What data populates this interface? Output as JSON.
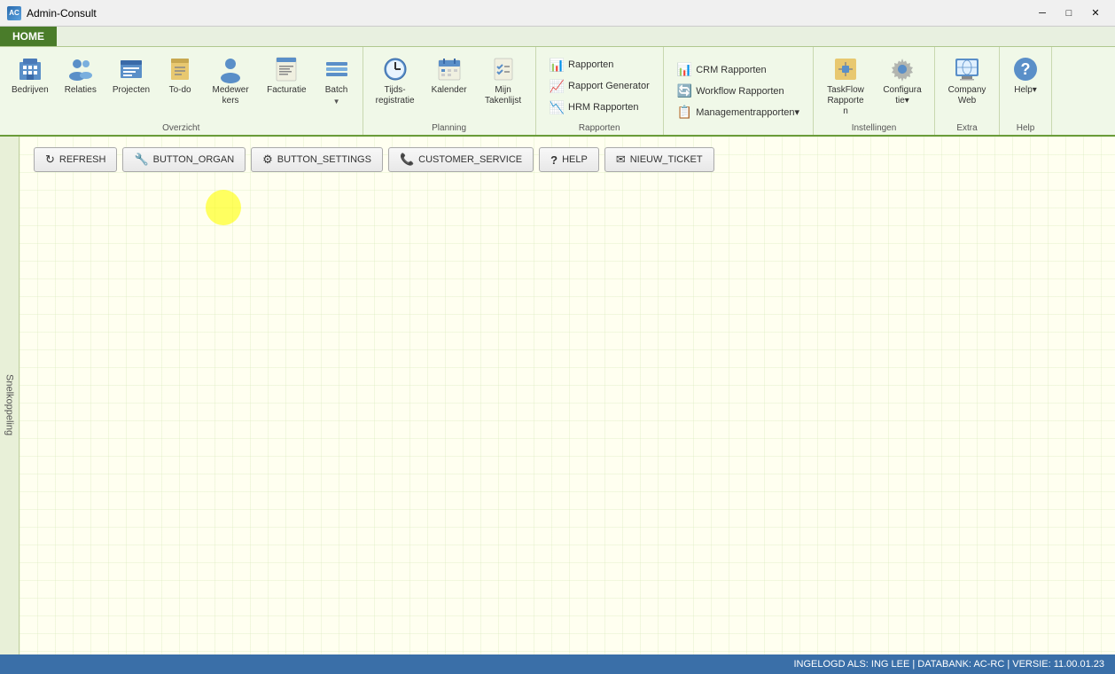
{
  "app": {
    "title": "Admin-Consult",
    "icon": "AC"
  },
  "titlebar": {
    "minimize": "─",
    "maximize": "□",
    "close": "✕"
  },
  "ribbon": {
    "home_tab": "HOME",
    "groups": {
      "overzicht": {
        "label": "Overzicht",
        "items": [
          {
            "id": "bedrijven",
            "label": "Bedrijven",
            "icon": "🏢"
          },
          {
            "id": "relaties",
            "label": "Relaties",
            "icon": "👥"
          },
          {
            "id": "projecten",
            "label": "Projecten",
            "icon": "📋"
          },
          {
            "id": "todo",
            "label": "To-do",
            "icon": "☑"
          },
          {
            "id": "medewerkers",
            "label": "Medewerkers",
            "icon": "👤"
          },
          {
            "id": "facturatie",
            "label": "Facturatie",
            "icon": "📄"
          },
          {
            "id": "batch",
            "label": "Batch",
            "icon": "📦",
            "has_arrow": true
          }
        ]
      },
      "planning": {
        "label": "Planning",
        "items": [
          {
            "id": "tijdsregistratie",
            "label": "Tijds­registratie",
            "icon": "⏱"
          },
          {
            "id": "kalender",
            "label": "Kalender",
            "icon": "📅"
          },
          {
            "id": "taken",
            "label": "Mijn Takenlijst",
            "icon": "📝"
          }
        ]
      },
      "rapporten": {
        "label": "Rapporten",
        "items": [
          {
            "id": "rapporten",
            "label": "Rapporten",
            "icon": "📊"
          },
          {
            "id": "rapport_generator",
            "label": "Rapport Generator",
            "icon": "📈"
          },
          {
            "id": "hrm_rapporten",
            "label": "HRM Rapporten",
            "icon": "📉"
          },
          {
            "id": "crm_rapporten",
            "label": "CRM Rapporten",
            "icon": "📊"
          },
          {
            "id": "workflow_rapporten",
            "label": "Workflow Rapporten",
            "icon": "🔄"
          },
          {
            "id": "management_rapporten",
            "label": "Managementrapporten",
            "icon": "📋",
            "has_arrow": true
          }
        ]
      },
      "instellingen": {
        "label": "Instellingen",
        "items": [
          {
            "id": "taskflow",
            "label": "TaskFlow Rapporten",
            "icon": "⚙"
          },
          {
            "id": "configuratie",
            "label": "Configuratie",
            "icon": "⚙",
            "has_arrow": true
          }
        ]
      },
      "extra": {
        "label": "Extra",
        "items": [
          {
            "id": "companyweb",
            "label": "CompanyWeb",
            "icon": "🌐"
          }
        ]
      },
      "help": {
        "label": "Help",
        "items": [
          {
            "id": "help",
            "label": "Help",
            "icon": "❓",
            "has_arrow": true
          }
        ]
      }
    }
  },
  "action_buttons": [
    {
      "id": "refresh",
      "label": "REFRESH",
      "icon": "↻"
    },
    {
      "id": "button_organ",
      "label": "BUTTON_ORGAN",
      "icon": "🔧"
    },
    {
      "id": "button_settings",
      "label": "BUTTON_SETTINGS",
      "icon": "⚙"
    },
    {
      "id": "customer_service",
      "label": "CUSTOMER_SERVICE",
      "icon": "📞"
    },
    {
      "id": "help",
      "label": "HELP",
      "icon": "?"
    },
    {
      "id": "nieuw_ticket",
      "label": "NIEUW_TICKET",
      "icon": "✉"
    }
  ],
  "sidebar": {
    "label": "Snelkoppeling"
  },
  "status_bar": {
    "text": "INGELOGD ALS:  ING LEE  |  DATABANK:  AC-RC  |  VERSIE:  11.00.01.23"
  }
}
